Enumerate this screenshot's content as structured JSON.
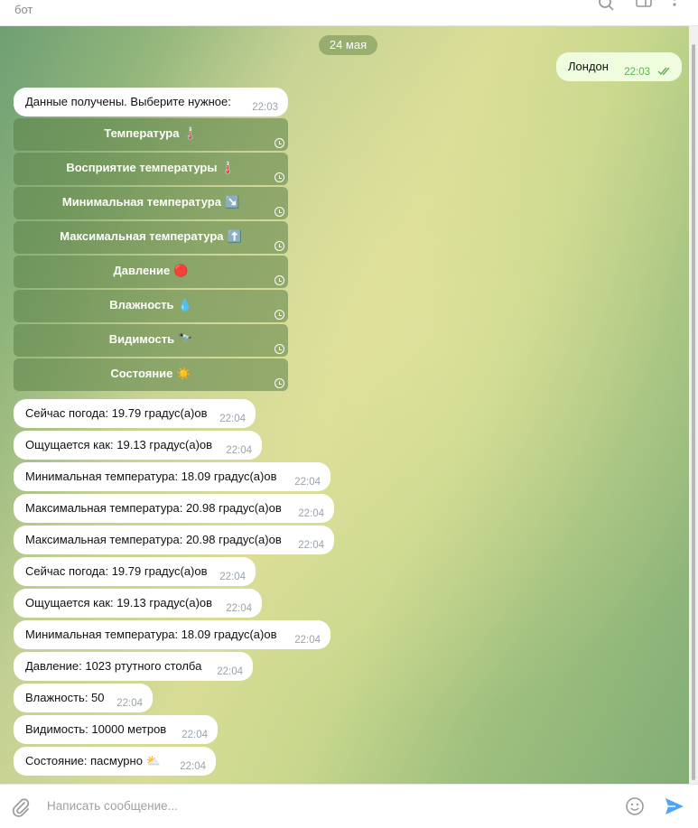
{
  "header": {
    "subtitle": "бот"
  },
  "chat": {
    "date": "24 мая",
    "outgoing": {
      "text": "Лондон",
      "time": "22:03"
    },
    "prompt": {
      "text": "Данные получены. Выберите нужное:",
      "time": "22:03"
    },
    "keyboard": [
      {
        "label": "Температура",
        "emoji": "🌡️"
      },
      {
        "label": "Восприятие температуры",
        "emoji": "🌡️"
      },
      {
        "label": "Минимальная температура",
        "emoji": "↘️"
      },
      {
        "label": "Максимальная температура",
        "emoji": "⬆️"
      },
      {
        "label": "Давление",
        "emoji": "🔴"
      },
      {
        "label": "Влажность",
        "emoji": "💧"
      },
      {
        "label": "Видимость",
        "emoji": "🔭"
      },
      {
        "label": "Состояние",
        "emoji": "☀️"
      }
    ],
    "messages": [
      {
        "text": "Сейчас погода: 19.79 градус(а)ов",
        "time": "22:04"
      },
      {
        "text": "Ощущается как: 19.13 градус(а)ов",
        "time": "22:04"
      },
      {
        "text": "Минимальная температура: 18.09 градус(а)ов",
        "time": "22:04"
      },
      {
        "text": "Максимальная температура: 20.98 градус(а)ов",
        "time": "22:04"
      },
      {
        "text": "Максимальная температура: 20.98 градус(а)ов",
        "time": "22:04"
      },
      {
        "text": "Сейчас погода: 19.79 градус(а)ов",
        "time": "22:04"
      },
      {
        "text": "Ощущается как: 19.13 градус(а)ов",
        "time": "22:04"
      },
      {
        "text": "Минимальная температура: 18.09 градус(а)ов",
        "time": "22:04"
      },
      {
        "text": "Давление: 1023 ртутного столба",
        "time": "22:04"
      },
      {
        "text": "Влажность: 50",
        "time": "22:04"
      },
      {
        "text": "Видимость: 10000 метров",
        "time": "22:04"
      },
      {
        "text": "Состояние: пасмурно ⛅",
        "time": "22:04"
      }
    ]
  },
  "composer": {
    "placeholder": "Написать сообщение..."
  },
  "icons": {
    "search": "search-icon",
    "sidebar": "sidebar-toggle-icon",
    "more": "more-vertical-icon",
    "attach": "paperclip-icon",
    "emoji": "emoji-icon",
    "send": "send-icon"
  },
  "colors": {
    "accent": "#4ea4f6",
    "outgoing_bubble": "#effdde",
    "read_checks": "#5fb05a"
  }
}
